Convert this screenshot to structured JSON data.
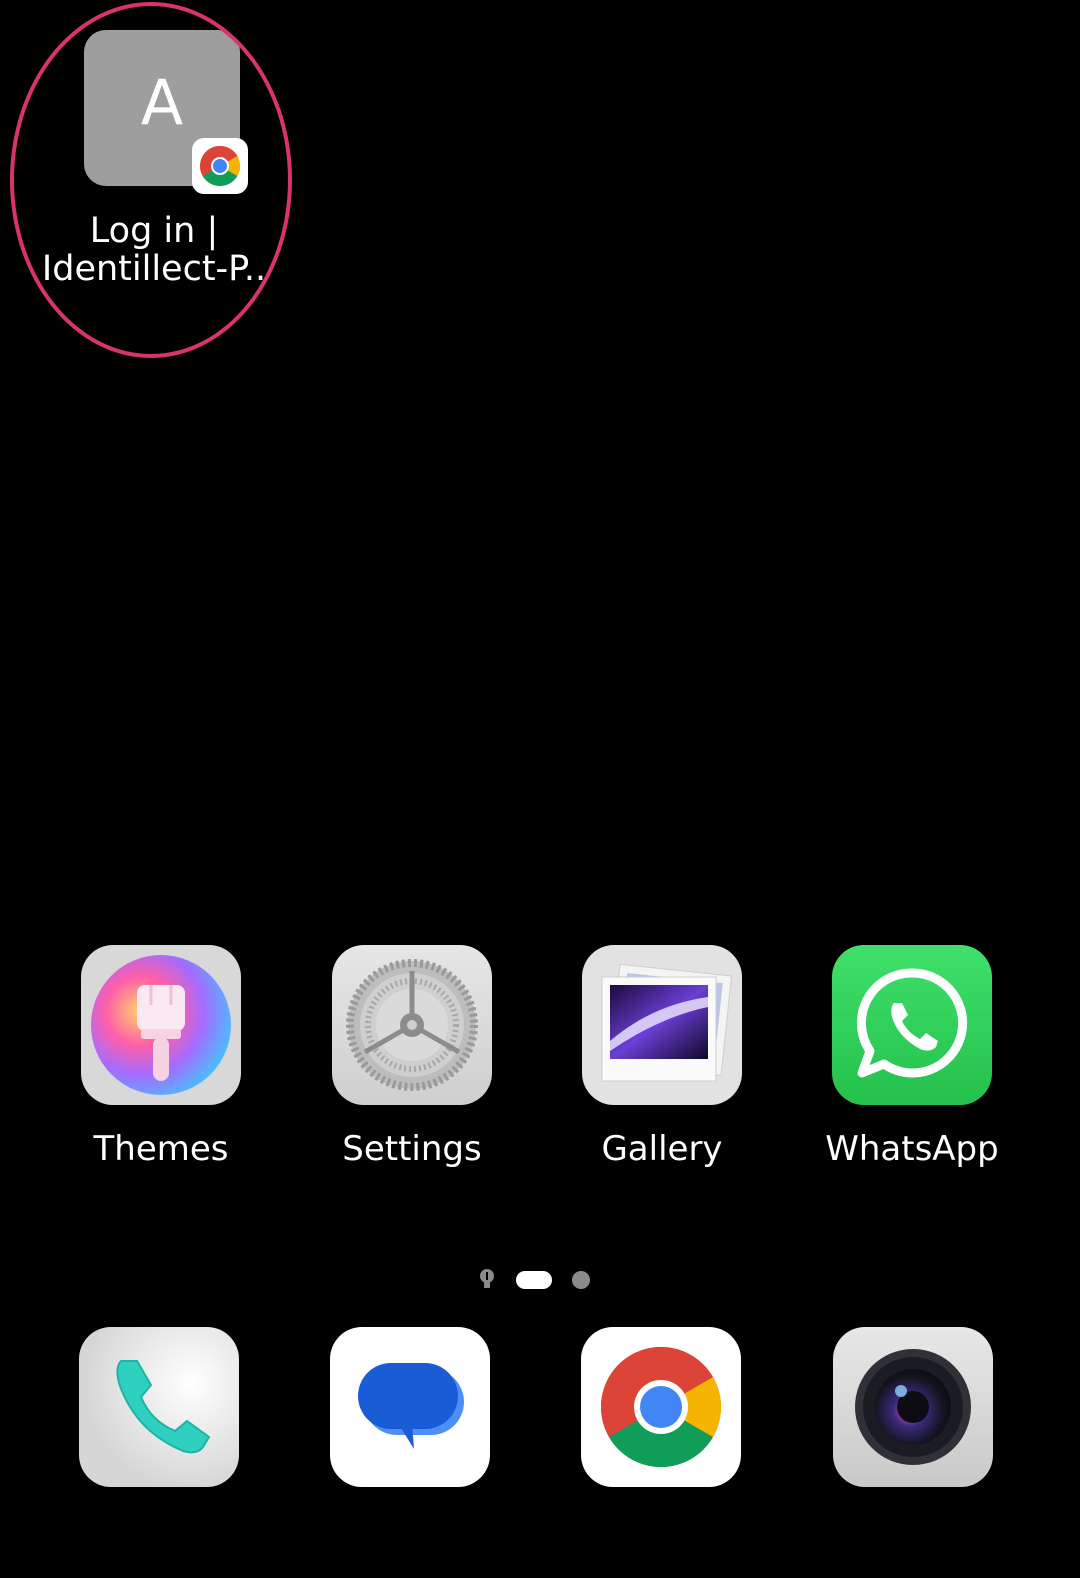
{
  "shortcut": {
    "letter": "A",
    "label": "Log in |\nIdentillect-P..",
    "badge_icon": "chrome-icon",
    "highlight_color": "#d8336f"
  },
  "apps": [
    {
      "label": "Themes",
      "icon": "themes-brush-icon"
    },
    {
      "label": "Settings",
      "icon": "settings-gear-icon"
    },
    {
      "label": "Gallery",
      "icon": "gallery-photos-icon"
    },
    {
      "label": "WhatsApp",
      "icon": "whatsapp-icon"
    }
  ],
  "pager": {
    "pages": 3,
    "active_index": 1
  },
  "dock": [
    {
      "icon": "phone-icon"
    },
    {
      "icon": "messages-icon"
    },
    {
      "icon": "chrome-icon"
    },
    {
      "icon": "camera-icon"
    }
  ],
  "colors": {
    "background": "#000000",
    "whatsapp_green": "#25d366",
    "shortcut_tile": "#9e9e9e"
  }
}
